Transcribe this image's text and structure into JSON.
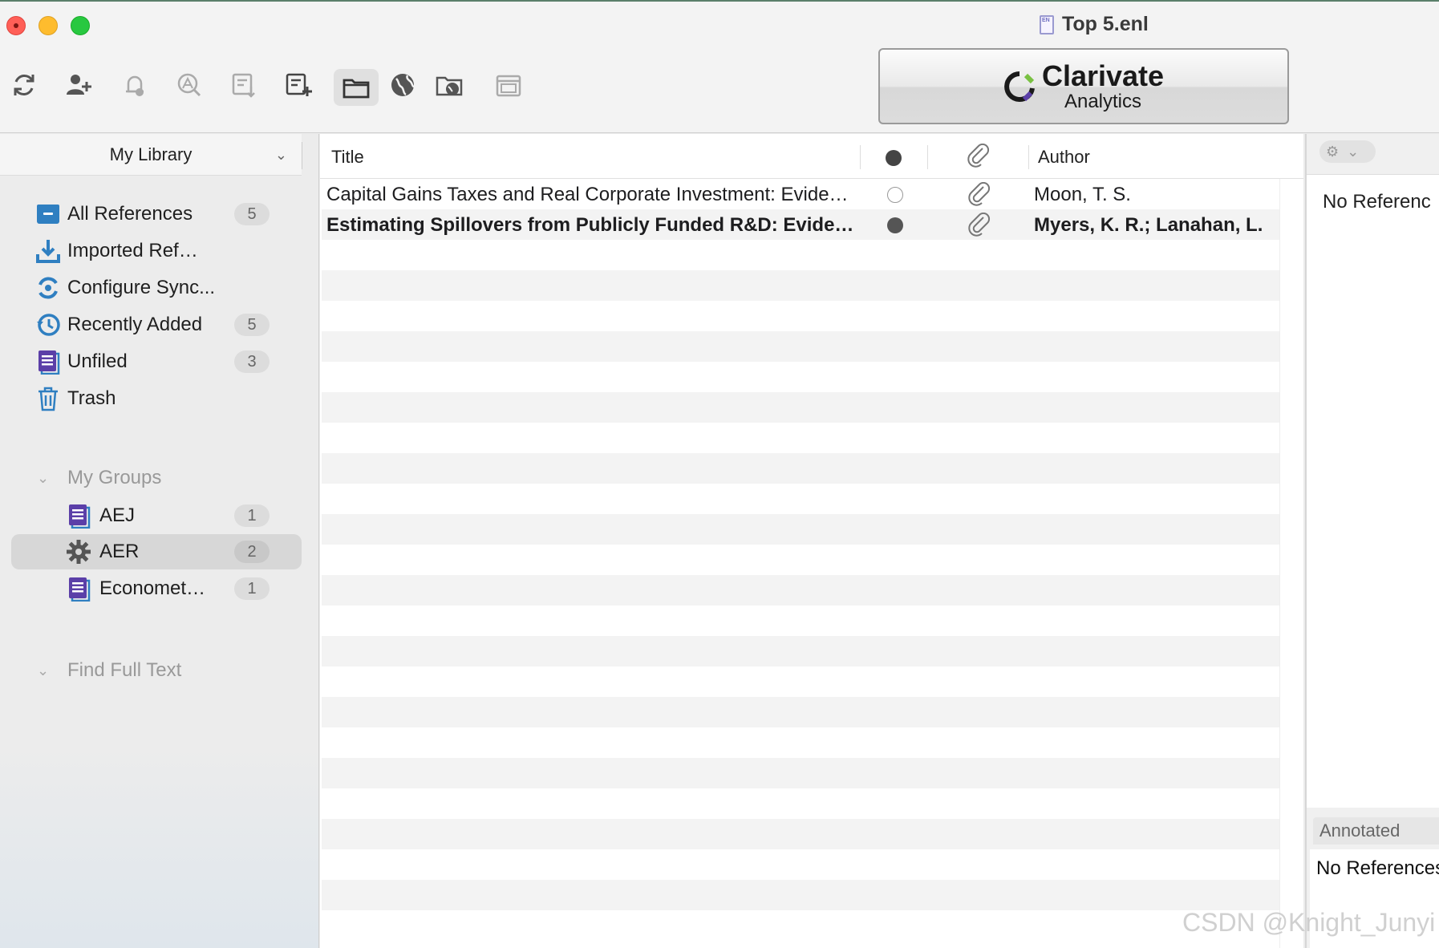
{
  "window": {
    "title": "Top 5.enl"
  },
  "toolbar": {
    "buttons": [
      {
        "name": "sync-icon"
      },
      {
        "name": "add-user-icon"
      },
      {
        "name": "notification-icon"
      },
      {
        "name": "find-pdf-icon"
      },
      {
        "name": "import-icon"
      },
      {
        "name": "new-reference-icon"
      },
      {
        "name": "folder-icon"
      },
      {
        "name": "globe-icon"
      },
      {
        "name": "online-folder-icon"
      },
      {
        "name": "preview-panel-icon"
      }
    ],
    "banner": {
      "brand": "Clarivate",
      "sub": "Analytics"
    }
  },
  "sidebar": {
    "library_label": "My Library",
    "items": [
      {
        "label": "All References",
        "count": "5",
        "icon": "all-references-icon"
      },
      {
        "label": "Imported Ref…",
        "count": "",
        "icon": "imported-icon"
      },
      {
        "label": "Configure Sync...",
        "count": "",
        "icon": "sync-config-icon"
      },
      {
        "label": "Recently Added",
        "count": "5",
        "icon": "recent-icon"
      },
      {
        "label": "Unfiled",
        "count": "3",
        "icon": "unfiled-icon"
      },
      {
        "label": "Trash",
        "count": "",
        "icon": "trash-icon"
      }
    ],
    "groups_header": "My Groups",
    "groups": [
      {
        "label": "AEJ",
        "count": "1",
        "icon": "group-icon"
      },
      {
        "label": "AER",
        "count": "2",
        "icon": "smart-group-gear-icon",
        "selected": true
      },
      {
        "label": "Economet…",
        "count": "1",
        "icon": "group-icon"
      }
    ],
    "find_full_text": "Find Full Text"
  },
  "list": {
    "columns": {
      "title": "Title",
      "read": "",
      "attachment": "",
      "author": "Author"
    },
    "rows": [
      {
        "title": "Capital Gains Taxes and Real Corporate Investment: Evide…",
        "read": true,
        "attachment": true,
        "author": "Moon, T. S.",
        "bold": false
      },
      {
        "title": "Estimating Spillovers from Publicly Funded R&D: Evide…",
        "read": false,
        "attachment": true,
        "author": "Myers, K. R.; Lanahan, L.",
        "bold": true
      }
    ]
  },
  "right_panel": {
    "top_text": "No Referenc",
    "annotated_label": "Annotated",
    "annotated_text": "No References"
  },
  "watermark": "CSDN @Knight_Junyi",
  "colors": {
    "accent_purple": "#5b3fa8",
    "accent_blue": "#2f7fc1",
    "clarivate_green": "#79c142"
  }
}
